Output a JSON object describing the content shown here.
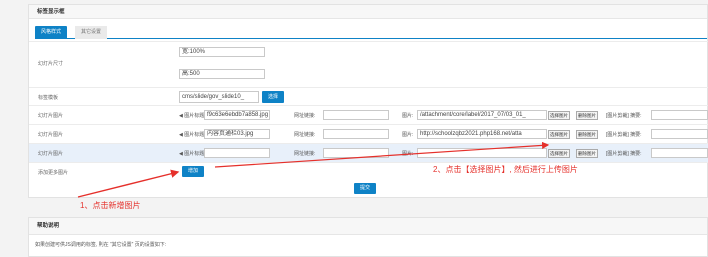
{
  "tag_panel": {
    "title": "标签显示框"
  },
  "tabs": [
    {
      "label": "风格样式"
    },
    {
      "label": "其它设置"
    }
  ],
  "rows": {
    "size": {
      "label": "幻灯片尺寸",
      "width_value": "宽:100%",
      "height_value": "高:500"
    },
    "template": {
      "label": "标签模板",
      "value": "cms/slide/gov_slide10_",
      "button": "选择"
    },
    "slides": [
      {
        "label": "幻灯片图片",
        "title_prefix": "◀ 图片标题:",
        "title_value": "f9c63e6ebdb7a858.jpg",
        "link_label": "网址链接:",
        "link_value": "",
        "image_label": "图片:",
        "image_value": "/attachment/core/label/2017_07/03_01_",
        "select_btn": "选择图片",
        "delete_btn": "删除图片",
        "crop_label": "[图片剪裁] 摘要:",
        "summary_value": ""
      },
      {
        "label": "幻灯片图片",
        "title_prefix": "◀ 图片标题:",
        "title_value": "内容页通栏03.jpg",
        "link_label": "网址链接:",
        "link_value": "",
        "image_label": "图片:",
        "image_value": "http://schoolzqbz2021.php168.net/atta",
        "select_btn": "选择图片",
        "delete_btn": "删除图片",
        "crop_label": "[图片剪裁] 摘要:",
        "summary_value": ""
      },
      {
        "label": "幻灯片图片",
        "title_prefix": "◀ 图片标题:",
        "title_value": "",
        "link_label": "网址链接:",
        "link_value": "",
        "image_label": "图片:",
        "image_value": "",
        "select_btn": "选择图片",
        "delete_btn": "删除图片",
        "crop_label": "[图片剪裁] 摘要:",
        "summary_value": ""
      }
    ],
    "add_more": {
      "label": "添加更多图片",
      "button": "增加"
    }
  },
  "submit_button": "提交",
  "help_panel": {
    "title": "帮助说明",
    "text": "如果创建可供JS调用的标签, 則在 “其它设置” 页的设置如下:"
  },
  "annotations": {
    "step1": "1、点击新增图片",
    "step2": "2、点击【选择图片】, 然后进行上传图片"
  },
  "colors": {
    "accent": "#0e82c6",
    "annotation": "#e5302b",
    "highlight_row": "#e8f0fa"
  }
}
